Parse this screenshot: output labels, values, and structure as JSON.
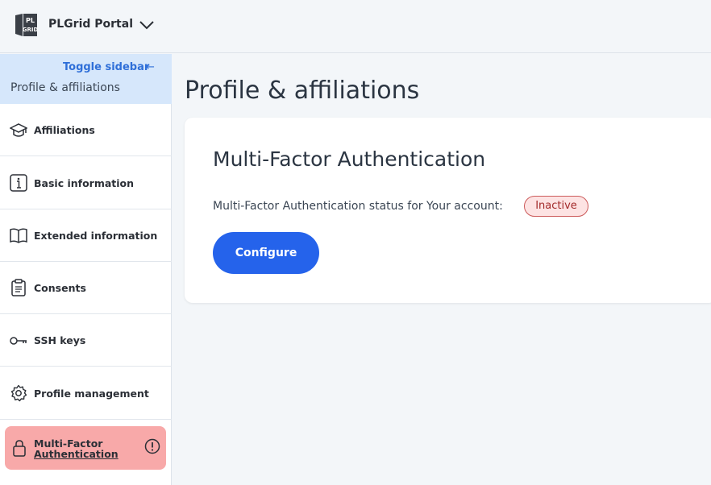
{
  "app": {
    "title": "PLGrid Portal"
  },
  "sidebar": {
    "toggle_label": "Toggle sidebar",
    "toggle_arrow": "←",
    "section_title": "Profile & affiliations",
    "items": [
      {
        "label": "Affiliations",
        "icon": "graduation-cap-icon"
      },
      {
        "label": "Basic information",
        "icon": "info-icon"
      },
      {
        "label": "Extended information",
        "icon": "book-icon"
      },
      {
        "label": "Consents",
        "icon": "clipboard-icon"
      },
      {
        "label": "SSH keys",
        "icon": "key-icon"
      },
      {
        "label": "Profile management",
        "icon": "gear-icon"
      }
    ],
    "active_item": {
      "line1": "Multi-Factor",
      "line2": "Authentication",
      "icon": "lock-icon",
      "status_icon": "alert-circle-icon",
      "color": "#f8a9a9"
    }
  },
  "main": {
    "page_title": "Profile & affiliations",
    "card": {
      "title": "Multi-Factor Authentication",
      "status_text": "Multi-Factor Authentication status for Your account:",
      "status_badge": "Inactive",
      "configure_label": "Configure"
    }
  },
  "colors": {
    "accent": "#2563eb",
    "sidebar_header": "#d6e7fb",
    "badge_border": "#cc5b5b",
    "background": "#f3f6f9"
  }
}
